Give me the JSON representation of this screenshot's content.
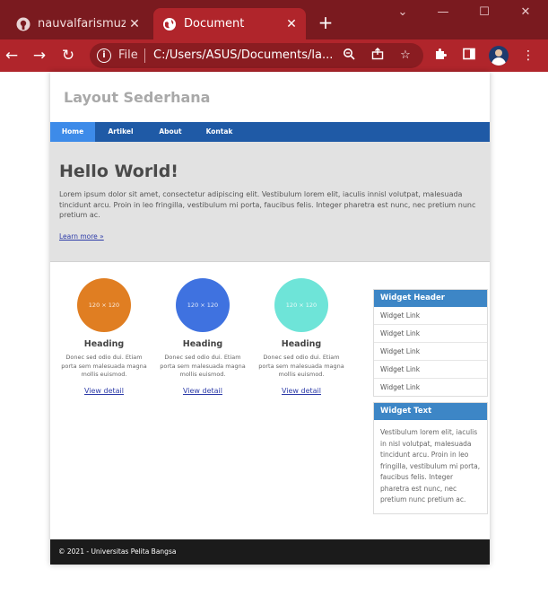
{
  "browser": {
    "tabs": [
      {
        "title": "nauvalfarismuzaki/la",
        "active": false,
        "favicon": "github-icon"
      },
      {
        "title": "Document",
        "active": true,
        "favicon": "globe-icon"
      }
    ],
    "new_tab": "+",
    "window_controls": {
      "minimize": "—",
      "maximize": "☐",
      "close": "✕",
      "dropdown": "⌄"
    },
    "address": {
      "scheme_label": "File",
      "url": "C:/Users/ASUS/Documents/la..."
    },
    "colors": {
      "frame": "#7a1a1f",
      "toolbar": "#b0252b"
    }
  },
  "page": {
    "site_title": "Layout Sederhana",
    "nav": [
      {
        "label": "Home",
        "active": true
      },
      {
        "label": "Artikel",
        "active": false
      },
      {
        "label": "About",
        "active": false
      },
      {
        "label": "Kontak",
        "active": false
      }
    ],
    "hero": {
      "heading": "Hello World!",
      "text": "Lorem ipsum dolor sit amet, consectetur adipiscing elit. Vestibulum lorem elit, iaculis innisl volutpat, malesuada tincidunt arcu. Proin in leo fringilla, vestibulum mi porta, faucibus felis. Integer pharetra est nunc, nec pretium nunc pretium ac.",
      "link": "Learn more »"
    },
    "cards": [
      {
        "image_label": "120 × 120",
        "color": "#e07e22",
        "heading": "Heading",
        "text": "Donec sed odio dui. Etiam porta sem malesuada magna mollis euismod.",
        "link": "View detail"
      },
      {
        "image_label": "120 × 120",
        "color": "#3f72e0",
        "heading": "Heading",
        "text": "Donec sed odio dui. Etiam porta sem malesuada magna mollis euismod.",
        "link": "View detail"
      },
      {
        "image_label": "120 × 120",
        "color": "#6ee4d8",
        "heading": "Heading",
        "text": "Donec sed odio dui. Etiam porta sem malesuada magna mollis euismod.",
        "link": "View detail"
      }
    ],
    "widget_links": {
      "header": "Widget Header",
      "links": [
        "Widget Link",
        "Widget Link",
        "Widget Link",
        "Widget Link",
        "Widget Link"
      ]
    },
    "widget_text": {
      "header": "Widget Text",
      "text": "Vestibulum lorem elit, iaculis in nisl volutpat, malesuada tincidunt arcu. Proin in leo fringilla, vestibulum mi porta, faucibus felis. Integer pharetra est nunc, nec pretium nunc pretium ac."
    },
    "footer": "© 2021 - Universitas Pelita Bangsa",
    "colors": {
      "nav": "#1f5aa6",
      "nav_active": "#3d8be9",
      "widget_header": "#3d86c6",
      "footer": "#1b1b1b"
    }
  }
}
